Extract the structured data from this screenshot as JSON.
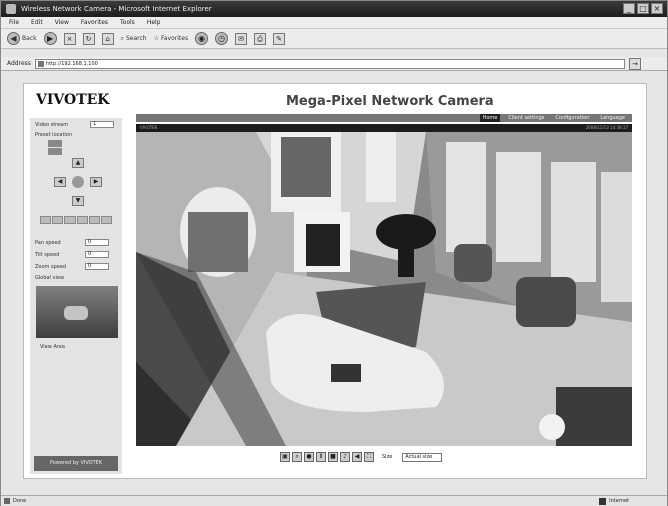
{
  "window": {
    "title": "Wireless Network Camera - Microsoft Internet Explorer",
    "buttons": [
      "_",
      "□",
      "×"
    ]
  },
  "menu": [
    "File",
    "Edit",
    "View",
    "Favorites",
    "Tools",
    "Help"
  ],
  "toolbar": {
    "back": "Back",
    "search": "Search",
    "favorites": "Favorites"
  },
  "address": {
    "label": "Address",
    "url": "http://192.168.1.100"
  },
  "page": {
    "logo": "VIVOTEK",
    "title": "Mega-Pixel Network Camera"
  },
  "nav": {
    "tabs": [
      "Home",
      "Client settings",
      "Configuration",
      "Language"
    ],
    "active": 0
  },
  "side": {
    "stream_label": "Video stream",
    "stream_value": "1",
    "preset_label": "Preset location",
    "pan_label": "Pan speed",
    "pan_value": "0",
    "tilt_label": "Tilt speed",
    "tilt_value": "0",
    "zoom_label": "Zoom speed",
    "zoom_value": "0",
    "global_label": "Global view",
    "viewarea_label": "View Area",
    "footer": "Powered by VIVOTEK"
  },
  "video": {
    "timestamp": "2008/11/13 14:38:17",
    "label": "VIVOTEK"
  },
  "controls": {
    "size_label": "Size",
    "size_value": "Actual size"
  },
  "status": {
    "left": "Done",
    "zone": "Internet"
  }
}
